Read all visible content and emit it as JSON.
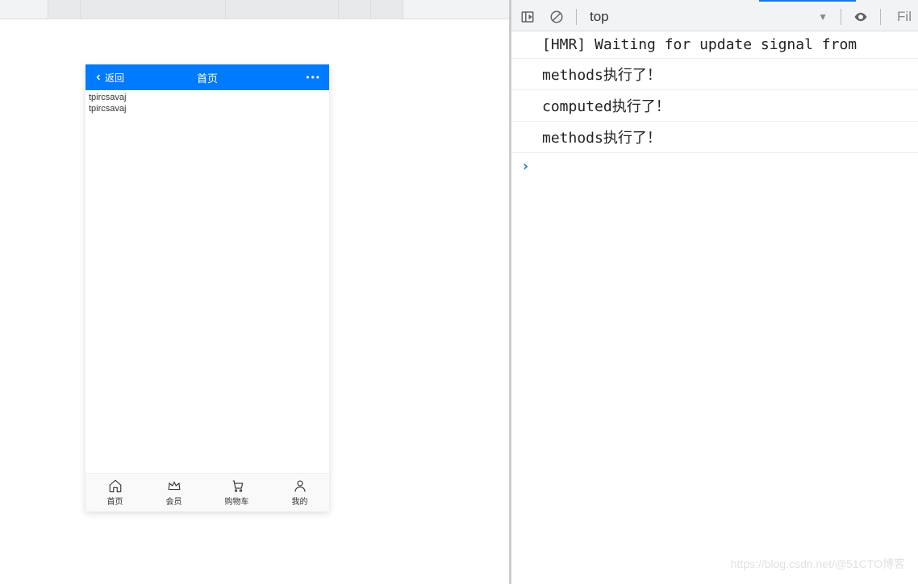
{
  "mobile": {
    "back_label": "返回",
    "title": "首页",
    "more": "•••",
    "body_lines": [
      "tpircsavaj",
      "tpircsavaj"
    ],
    "tabbar": [
      {
        "label": "首页",
        "icon": "home"
      },
      {
        "label": "会员",
        "icon": "crown"
      },
      {
        "label": "购物车",
        "icon": "cart"
      },
      {
        "label": "我的",
        "icon": "user"
      }
    ]
  },
  "devtools": {
    "context": "top",
    "filter_placeholder": "Fil",
    "console": [
      "[HMR] Waiting for update signal from ",
      "methods执行了！",
      "computed执行了！",
      "methods执行了！"
    ]
  },
  "watermark": "https://blog.csdn.net/@51CTO博客"
}
